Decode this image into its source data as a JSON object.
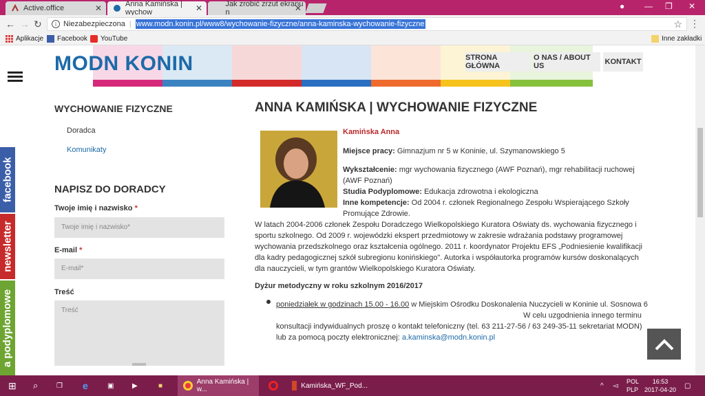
{
  "browser": {
    "tabs": [
      {
        "label": "Active.office",
        "active": false
      },
      {
        "label": "Anna Kamińska | wychow",
        "active": true
      },
      {
        "label": "Jak zrobić zrzut ekranu n",
        "active": false
      }
    ],
    "security_label": "Niezabezpieczona",
    "url": "www.modn.konin.pl/www8/wychowanie-fizyczne/anna-kaminska-wychowanie-fizyczne",
    "bookmarks": [
      {
        "label": "Aplikacje",
        "icon": "apps-grid-icon"
      },
      {
        "label": "Facebook",
        "icon": "facebook-icon"
      },
      {
        "label": "YouTube",
        "icon": "youtube-icon"
      }
    ],
    "other_bookmarks": "Inne zakładki"
  },
  "site": {
    "logo": "MODN KONIN",
    "nav": [
      "STRONA GŁÓWNA",
      "O NAS / ABOUT US",
      "KONTAKT"
    ],
    "tile_colors": [
      "#d6287a",
      "#3b83c0",
      "#d32a2a",
      "#2b6fc2",
      "#ee6b2d",
      "#f5c31b",
      "#86c13c"
    ]
  },
  "sidebar": {
    "section_title": "WYCHOWANIE FIZYCZNE",
    "links": [
      "Doradca",
      "Komunikaty"
    ],
    "form": {
      "title": "NAPISZ DO DORADCY",
      "name_label": "Twoje imię i nazwisko",
      "name_placeholder": "Twoje imię i nazwisko*",
      "email_label": "E-mail",
      "email_placeholder": "E-mail*",
      "message_label": "Treść",
      "message_placeholder": "Treść",
      "required_mark": "*"
    },
    "side_tabs": [
      {
        "label": "facebook",
        "color": "#3b5ea8"
      },
      {
        "label": "newsletter",
        "color": "#c62a2a"
      },
      {
        "label": "a podyplomowe",
        "color": "#6ea532"
      }
    ]
  },
  "main": {
    "title": "ANNA KAMIŃSKA | WYCHOWANIE FIZYCZNE",
    "person_name": "Kamińska Anna",
    "workplace_label": "Miejsce pracy:",
    "workplace": " Gimnazjum nr 5 w Koninie, ul. Szymanowskiego 5",
    "education_label": "Wykształcenie:",
    "education_1": " mgr wychowania fizycznego (AWF Poznań), mgr rehabilitacji ruchowej",
    "education_2": "(AWF Poznań)",
    "postgrad_label": "Studia Podyplomowe:",
    "postgrad": " Edukacja zdrowotna i ekologiczna",
    "competences_label": "Inne kompetencje:",
    "competences_1": " Od 2004 r. członek Regionalnego Zespołu Wspierającego Szkoły",
    "competences_2": "Promujące Zdrowie.",
    "bio": [
      "W latach 2004-2006 członek Zespołu Doradczego Wielkopolskiego Kuratora Oświaty ds. wychowania fizycznego i",
      "sportu szkolnego. Od 2009 r. wojewódzki ekspert przedmiotowy w zakresie wdrażania podstawy programowej",
      "wychowania przedszkolnego oraz kształcenia ogólnego. 2011 r. koordynator Projektu EFS „Podniesienie kwalifikacji",
      "dla kadry pedagogicznej szkół subregionu konińskiego\". Autorka i współautorka programów kursów doskonalących",
      "dla nauczycieli, w tym grantów Wielkopolskiego Kuratora Oświaty."
    ],
    "duty_title": "Dyżur metodyczny w roku szkolnym 2016/2017",
    "duty_when": "poniedziałek w godzinach 15.00 - 16.00",
    "duty_where": " w Miejskim Ośrodku Doskonalenia Nuczycieli w Koninie ul. Sosnowa 6",
    "duty_2": "W celu uzgodnienia innego terminu",
    "duty_3": "konsultacji indywidualnych proszę o kontakt telefoniczny (tel. 63 211-27-56 / 63 249-35-11 sekretariat MODN)",
    "duty_4": "lub za pomocą poczty elektronicznej: ",
    "email": "a.kaminska@modn.konin.pl"
  },
  "taskbar": {
    "apps": [
      {
        "label": "Anna Kamińska | w...",
        "icon": "chrome-icon"
      },
      {
        "label": "",
        "icon": "opera-icon"
      },
      {
        "label": "Kamińska_WF_Pod...",
        "icon": "powerpoint-icon"
      }
    ],
    "lang_1": "POL",
    "lang_2": "PLP",
    "time": "16:53",
    "date": "2017-04-20"
  }
}
